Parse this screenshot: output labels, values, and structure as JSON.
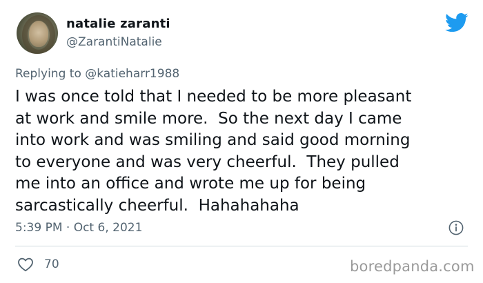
{
  "user": {
    "display_name": "natalie zaranti",
    "handle": "@ZarantiNatalie",
    "avatar_icon": "profile-photo"
  },
  "reply": {
    "prefix": "Replying to ",
    "mention": "@katieharr1988"
  },
  "tweet": {
    "text": "I was once told that I needed to be more pleasant\nat work and smile more.  So the next day I came\ninto work and was smiling and said good morning\nto everyone and was very cheerful.  They pulled\nme into an office and wrote me up for being\nsarcastically cheerful.  Hahahahaha",
    "timestamp": "5:39 PM · Oct 6, 2021",
    "like_count": "70"
  },
  "icons": {
    "brand": "twitter-bird-icon",
    "info": "info-icon",
    "like": "heart-icon"
  },
  "colors": {
    "twitter_blue": "#1d9bf0",
    "secondary_text": "#536471",
    "primary_text": "#0f1419",
    "divider": "#cfd9de",
    "watermark": "#9a9a9a"
  },
  "watermark": "boredpanda.com"
}
